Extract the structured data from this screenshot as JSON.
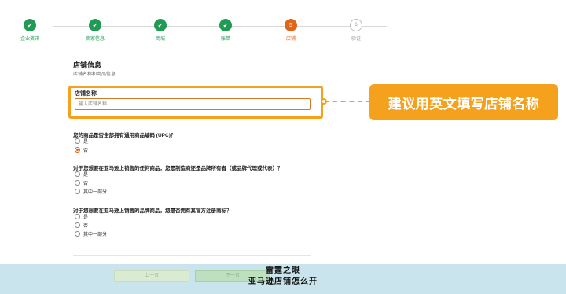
{
  "stepper": {
    "steps": [
      {
        "label": "企业资讯",
        "status": "done"
      },
      {
        "label": "卖家信息",
        "status": "done"
      },
      {
        "label": "商城",
        "status": "done"
      },
      {
        "label": "账单",
        "status": "done"
      },
      {
        "label": "店铺",
        "status": "active",
        "number": "5"
      },
      {
        "label": "验证",
        "status": "pending",
        "number": "6"
      }
    ],
    "check_glyph": "✔"
  },
  "form": {
    "title": "店铺信息",
    "subtitle": "店铺名称和商品信息",
    "store_name_label": "店铺名称",
    "store_name_value": "",
    "store_name_placeholder": "输入店铺名称",
    "callout_text": "建议用英文填写店铺名称",
    "questions": [
      {
        "text": "您的商品是否全部拥有通用商品编码 (UPC)？",
        "options": [
          {
            "label": "是",
            "checked": false
          },
          {
            "label": "否",
            "checked": true
          }
        ]
      },
      {
        "text": "对于您想要在亚马逊上销售的任何商品，您是制造商还是品牌所有者（或品牌代理或代表）？",
        "options": [
          {
            "label": "是",
            "checked": false
          },
          {
            "label": "否",
            "checked": false
          },
          {
            "label": "其中一部分",
            "checked": false
          }
        ]
      },
      {
        "text": "对于您想要在亚马逊上销售的品牌商品，您是否拥有其官方注册商标？",
        "options": [
          {
            "label": "是",
            "checked": false
          },
          {
            "label": "否",
            "checked": false
          },
          {
            "label": "其中一部分",
            "checked": false
          }
        ]
      }
    ]
  },
  "footer": {
    "prev_label": "上一页",
    "next_label": "下一页",
    "watermark_line1": "雷霆之眼",
    "watermark_line2": "亚马逊店铺怎么开"
  },
  "colors": {
    "done": "#1f9b54",
    "active": "#e0651b",
    "highlight": "#f4a21e",
    "band": "#c9e4ec"
  }
}
